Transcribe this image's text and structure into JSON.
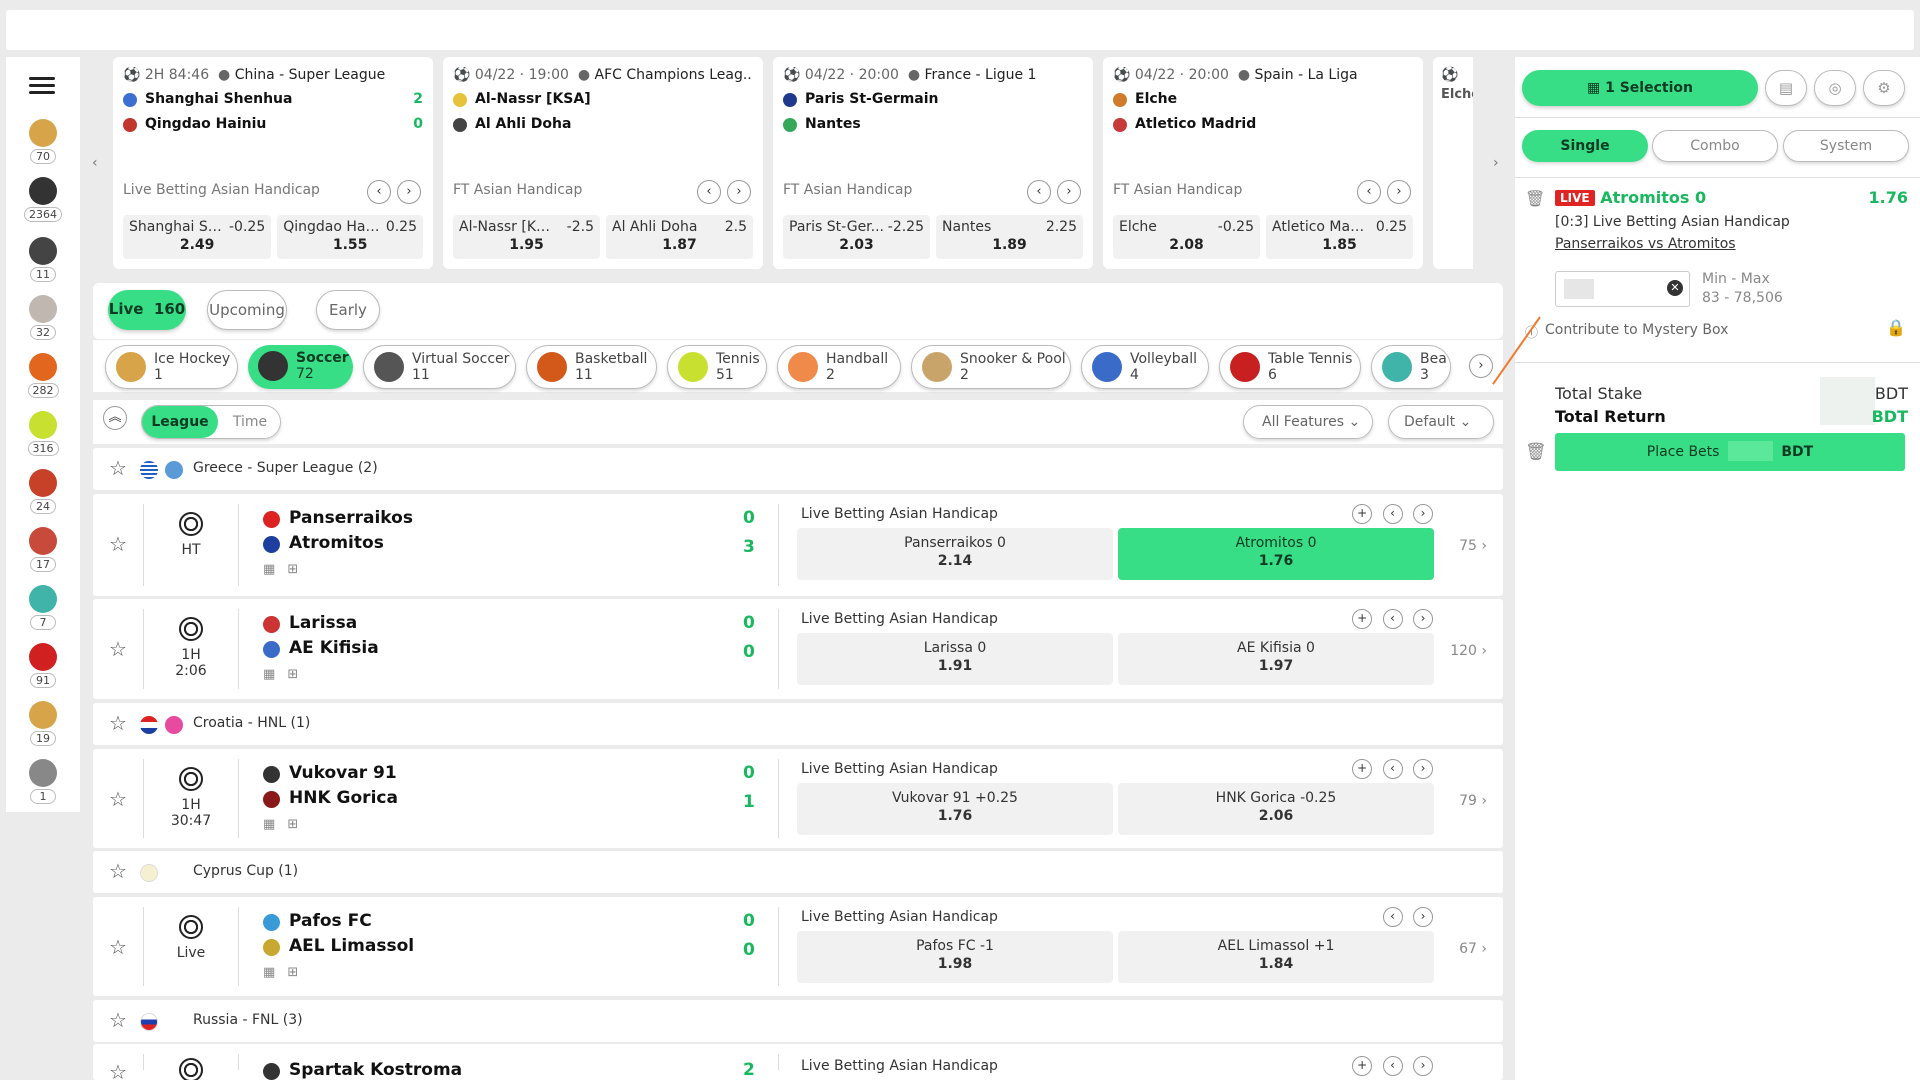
{
  "sidebar": {
    "sports": [
      {
        "icon": "hockey-stick-icon",
        "count": "70",
        "color": "#d7a44a"
      },
      {
        "icon": "soccer-ball-icon",
        "count": "2364",
        "color": "#333333"
      },
      {
        "icon": "virtual-soccer-icon",
        "count": "11",
        "color": "#444444"
      },
      {
        "icon": "baseball-icon",
        "count": "32",
        "color": "#c0b8b0"
      },
      {
        "icon": "basketball-icon",
        "count": "282",
        "color": "#e2661e"
      },
      {
        "icon": "tennis-ball-icon",
        "count": "316",
        "color": "#c8e030"
      },
      {
        "icon": "cricket-icon",
        "count": "24",
        "color": "#c64128"
      },
      {
        "icon": "rugby-ball-icon",
        "count": "17",
        "color": "#c84a3a"
      },
      {
        "icon": "badminton-icon",
        "count": "7",
        "color": "#40b4a8"
      },
      {
        "icon": "boxing-glove-icon",
        "count": "91",
        "color": "#d02020"
      },
      {
        "icon": "bat-icon",
        "count": "19",
        "color": "#d7a44a"
      },
      {
        "icon": "stopwatch-icon",
        "count": "1",
        "color": "#888888"
      }
    ]
  },
  "cards": [
    {
      "time": "2H 84:46",
      "league": "China - Super League",
      "home": "Shanghai Shenhua",
      "away": "Qingdao Hainiu",
      "home_score": "2",
      "away_score": "0",
      "market": "Live Betting Asian Handicap",
      "odds": [
        {
          "name": "Shanghai Sh...",
          "line": "-0.25",
          "value": "2.49"
        },
        {
          "name": "Qingdao Hain...",
          "line": "0.25",
          "value": "1.55"
        }
      ]
    },
    {
      "time": "04/22 · 19:00",
      "league": "AFC Champions Leag...",
      "home": "Al-Nassr [KSA]",
      "away": "Al Ahli Doha",
      "home_score": "",
      "away_score": "",
      "market": "FT Asian Handicap",
      "odds": [
        {
          "name": "Al-Nassr [KSA]",
          "line": "-2.5",
          "value": "1.95"
        },
        {
          "name": "Al Ahli Doha",
          "line": "2.5",
          "value": "1.87"
        }
      ]
    },
    {
      "time": "04/22 · 20:00",
      "league": "France - Ligue 1",
      "home": "Paris St-Germain",
      "away": "Nantes",
      "home_score": "",
      "away_score": "",
      "market": "FT Asian Handicap",
      "odds": [
        {
          "name": "Paris St-Ger...",
          "line": "-2.25",
          "value": "2.03"
        },
        {
          "name": "Nantes",
          "line": "2.25",
          "value": "1.89"
        }
      ]
    },
    {
      "time": "04/22 · 20:00",
      "league": "Spain - La Liga",
      "home": "Elche",
      "away": "Atletico Madrid",
      "home_score": "",
      "away_score": "",
      "market": "FT Asian Handicap",
      "odds": [
        {
          "name": "Elche",
          "line": "-0.25",
          "value": "2.08"
        },
        {
          "name": "Atletico Madrid",
          "line": "0.25",
          "value": "1.85"
        }
      ]
    }
  ],
  "card_cut": {
    "team": "Elche"
  },
  "filters": {
    "live_label": "Live",
    "live_count": "160",
    "upcoming": "Upcoming",
    "early": "Early"
  },
  "sport_chips": [
    {
      "name": "Ice Hockey",
      "count": "1",
      "color": "#d7a44a"
    },
    {
      "name": "Soccer",
      "count": "72",
      "color": "#333333"
    },
    {
      "name": "Virtual Soccer",
      "count": "11",
      "color": "#555555"
    },
    {
      "name": "Basketball",
      "count": "11",
      "color": "#d2591a"
    },
    {
      "name": "Tennis",
      "count": "51",
      "color": "#c8e030"
    },
    {
      "name": "Handball",
      "count": "2",
      "color": "#f08a4a"
    },
    {
      "name": "Snooker & Pool",
      "count": "2",
      "color": "#c9a46a"
    },
    {
      "name": "Volleyball",
      "count": "4",
      "color": "#3a6bc8"
    },
    {
      "name": "Table Tennis",
      "count": "6",
      "color": "#c82020"
    },
    {
      "name": "Bea",
      "count": "3",
      "color": "#40b4a8"
    }
  ],
  "controls": {
    "league": "League",
    "time": "Time",
    "features": "All Features",
    "sort": "Default"
  },
  "leagues": {
    "greece": "Greece - Super League (2)",
    "croatia": "Croatia - HNL (1)",
    "cyprus": "Cyprus Cup (1)",
    "russia": "Russia - FNL (3)"
  },
  "matches": [
    {
      "status": "HT",
      "home": "Panserraikos",
      "away": "Atromitos",
      "home_score": "0",
      "away_score": "3",
      "market": "Live Betting Asian Handicap",
      "odds": [
        {
          "label": "Panserraikos  0",
          "value": "2.14"
        },
        {
          "label": "Atromitos  0",
          "value": "1.76"
        }
      ],
      "more": "75"
    },
    {
      "status": "1H",
      "clock": "2:06",
      "home": "Larissa",
      "away": "AE Kifisia",
      "home_score": "0",
      "away_score": "0",
      "market": "Live Betting Asian Handicap",
      "odds": [
        {
          "label": "Larissa  0",
          "value": "1.91"
        },
        {
          "label": "AE Kifisia  0",
          "value": "1.97"
        }
      ],
      "more": "120"
    },
    {
      "status": "1H",
      "clock": "30:47",
      "home": "Vukovar 91",
      "away": "HNK Gorica",
      "home_score": "0",
      "away_score": "1",
      "market": "Live Betting Asian Handicap",
      "odds": [
        {
          "label": "Vukovar 91  +0.25",
          "value": "1.76"
        },
        {
          "label": "HNK Gorica  -0.25",
          "value": "2.06"
        }
      ],
      "more": "79"
    },
    {
      "status": "Live",
      "home": "Pafos FC",
      "away": "AEL Limassol",
      "home_score": "0",
      "away_score": "0",
      "market": "Live Betting Asian Handicap",
      "odds": [
        {
          "label": "Pafos FC  -1",
          "value": "1.98"
        },
        {
          "label": "AEL Limassol  +1",
          "value": "1.84"
        }
      ],
      "more": "67"
    },
    {
      "home": "Spartak Kostroma",
      "home_score": "2",
      "market": "Live Betting Asian Handicap"
    }
  ],
  "slip": {
    "selection": "1 Selection",
    "tabs": [
      "Single",
      "Combo",
      "System"
    ],
    "live": "LIVE",
    "pick": "Atromitos 0",
    "odds": "1.76",
    "market": "[0:3] Live Betting Asian Handicap",
    "event": "Panserraikos vs Atromitos",
    "minmax_label": "Min - Max",
    "minmax": "83 - 78,506",
    "mystery": "Contribute to Mystery Box",
    "total_stake": "Total Stake",
    "total_return": "Total Return",
    "currency": "BDT",
    "place_bets": "Place Bets"
  }
}
